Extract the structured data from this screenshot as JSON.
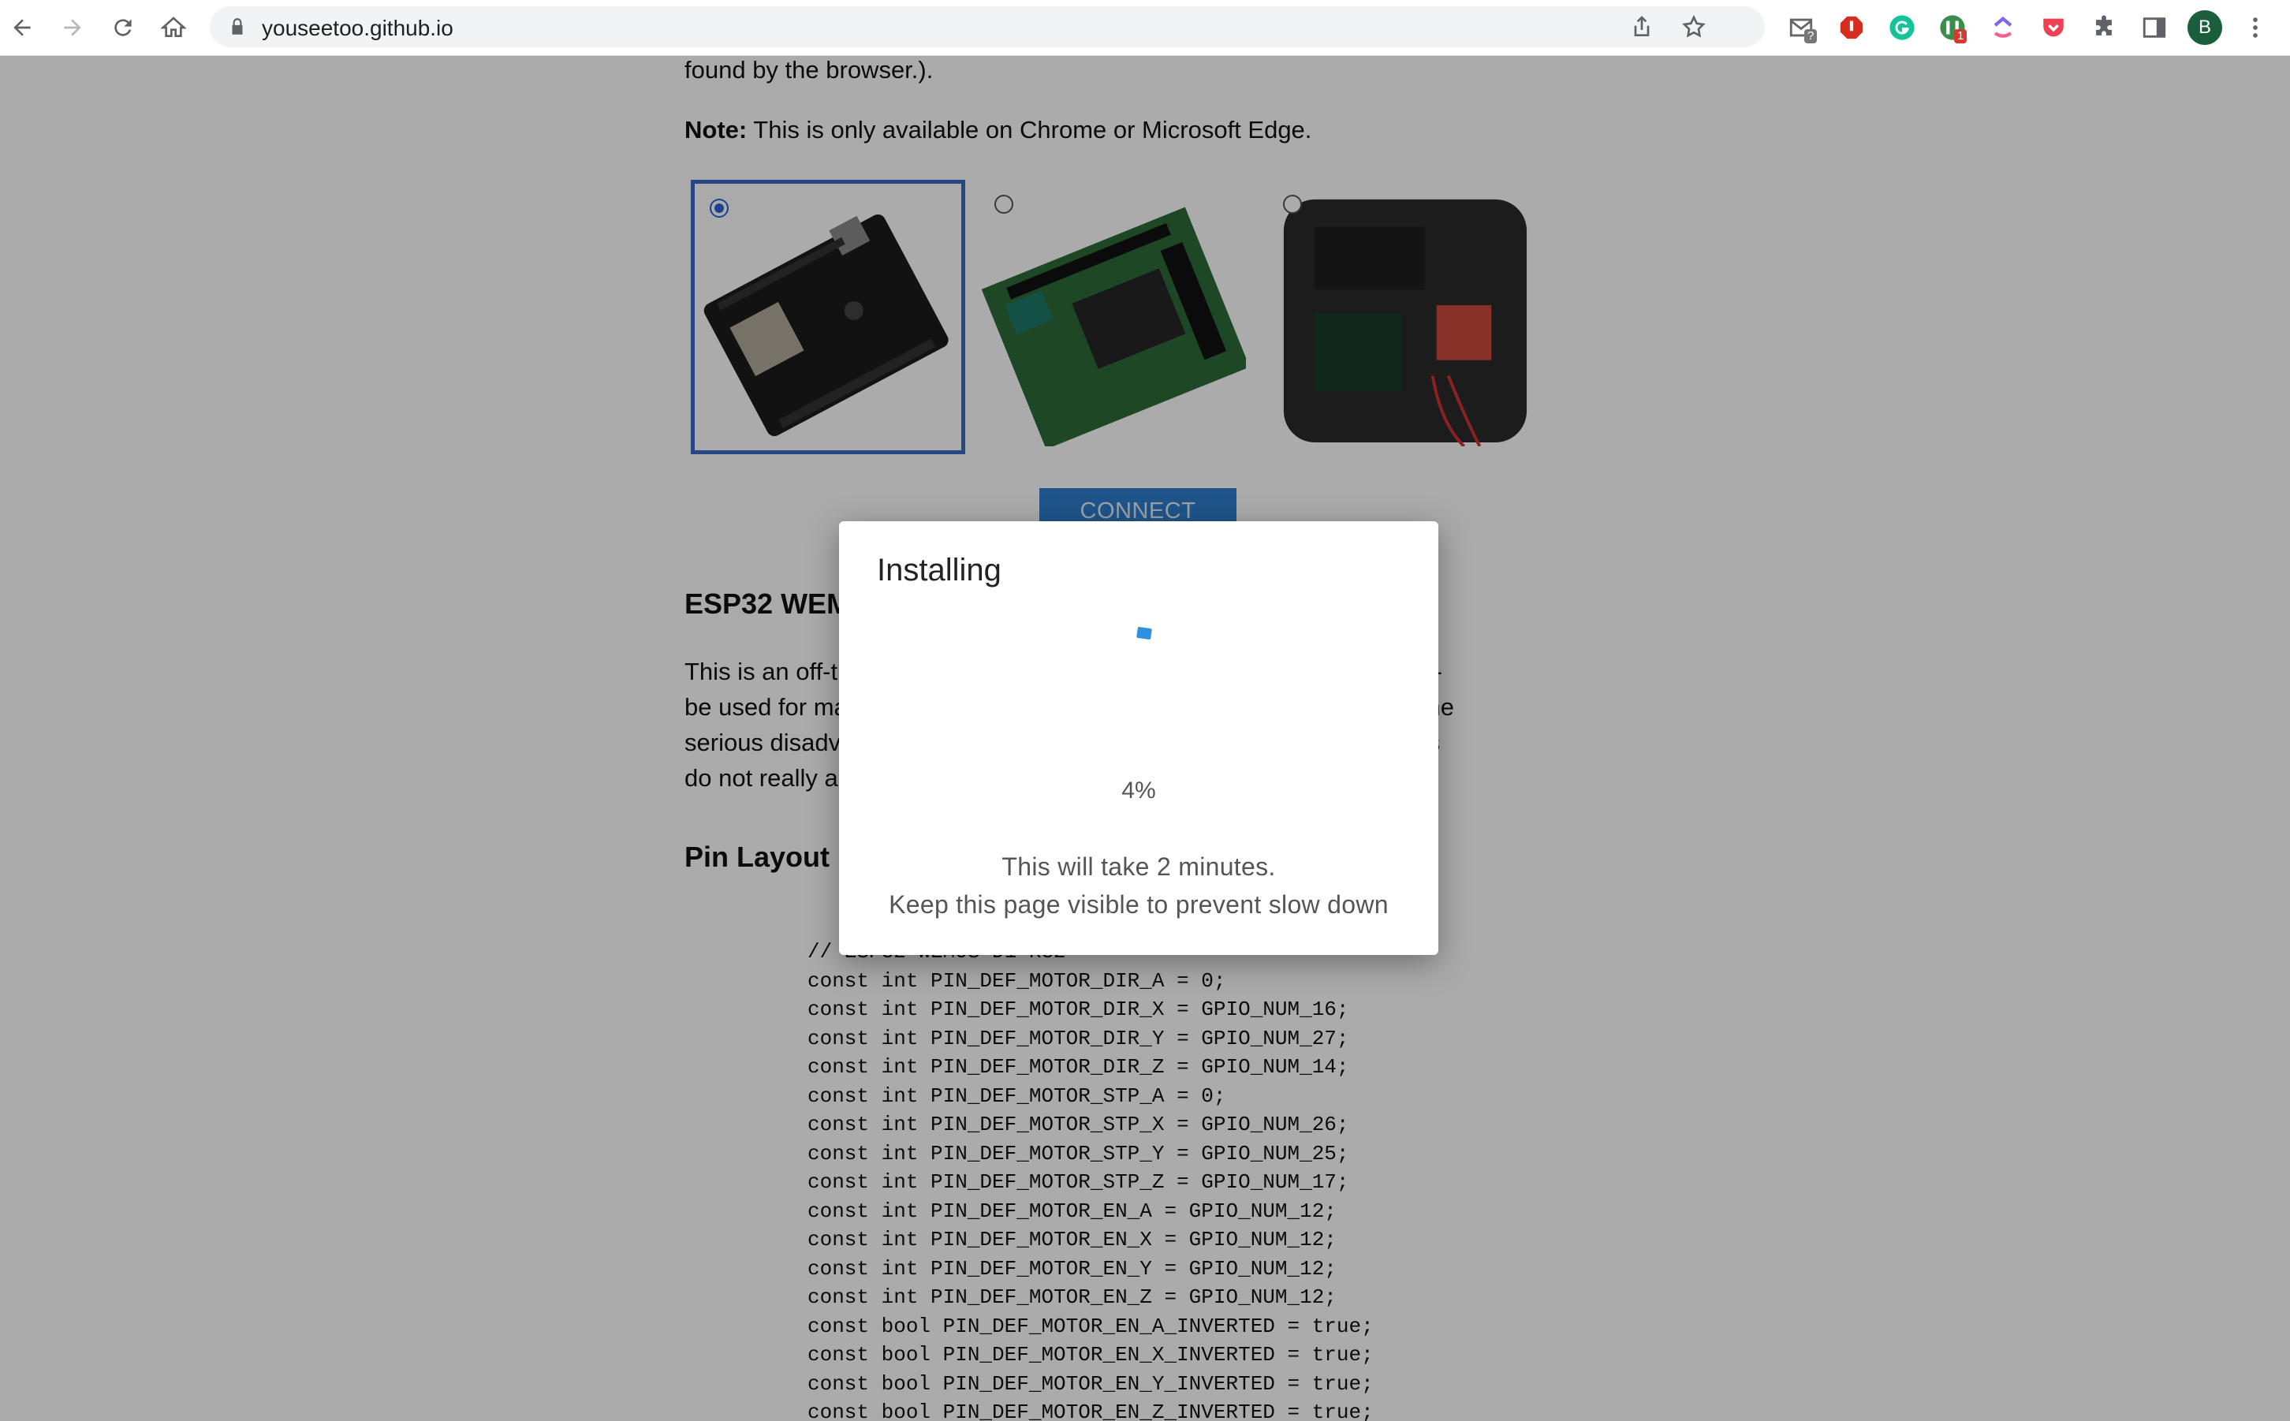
{
  "browser": {
    "url": "youseetoo.github.io",
    "extensions": [
      "gmail-icon",
      "adblock-icon",
      "grammarly-icon",
      "extension-green-icon",
      "clickup-icon",
      "pocket-icon",
      "puzzle-icon",
      "sidepanel-icon"
    ],
    "gmail_badge": "?",
    "green_ext_badge": "1",
    "profile_initial": "B"
  },
  "page": {
    "intro_tail": "found by the browser.).",
    "note_label": "Note:",
    "note_text": " This is only available on Chrome or Microsoft Edge.",
    "boards": [
      {
        "name": "esp32-d1-r32-board",
        "selected": true
      },
      {
        "name": "pcb-green-board",
        "selected": false
      },
      {
        "name": "enclosure-board",
        "selected": false
      }
    ],
    "connect_label": "CONNECT",
    "section_heading": "ESP32 WEMOS D1 R32",
    "para_lines": [
      "This is an off-the-shelf ESP32 board combined with a CNC Shield v3 -",
      "be used for many purposes and can be found on many sites today. The",
      "serious disadvantage is the limited number of pins and hence the pins",
      "do not really allow the use of additional sensors."
    ],
    "pin_heading": "Pin Layout",
    "code_lines": [
      "// ESP32-WEMOS-D1-R32",
      "const int PIN_DEF_MOTOR_DIR_A = 0;",
      "const int PIN_DEF_MOTOR_DIR_X = GPIO_NUM_16;",
      "const int PIN_DEF_MOTOR_DIR_Y = GPIO_NUM_27;",
      "const int PIN_DEF_MOTOR_DIR_Z = GPIO_NUM_14;",
      "const int PIN_DEF_MOTOR_STP_A = 0;",
      "const int PIN_DEF_MOTOR_STP_X = GPIO_NUM_26;",
      "const int PIN_DEF_MOTOR_STP_Y = GPIO_NUM_25;",
      "const int PIN_DEF_MOTOR_STP_Z = GPIO_NUM_17;",
      "const int PIN_DEF_MOTOR_EN_A = GPIO_NUM_12;",
      "const int PIN_DEF_MOTOR_EN_X = GPIO_NUM_12;",
      "const int PIN_DEF_MOTOR_EN_Y = GPIO_NUM_12;",
      "const int PIN_DEF_MOTOR_EN_Z = GPIO_NUM_12;",
      "const bool PIN_DEF_MOTOR_EN_A_INVERTED = true;",
      "const bool PIN_DEF_MOTOR_EN_X_INVERTED = true;",
      "const bool PIN_DEF_MOTOR_EN_Y_INVERTED = true;",
      "const bool PIN_DEF_MOTOR_EN_Z_INVERTED = true;"
    ]
  },
  "dialog": {
    "title": "Installing",
    "progress": "4%",
    "progress_value": 0.04,
    "message_line1": "This will take 2 minutes.",
    "message_line2": "Keep this page visible to prevent slow down"
  }
}
